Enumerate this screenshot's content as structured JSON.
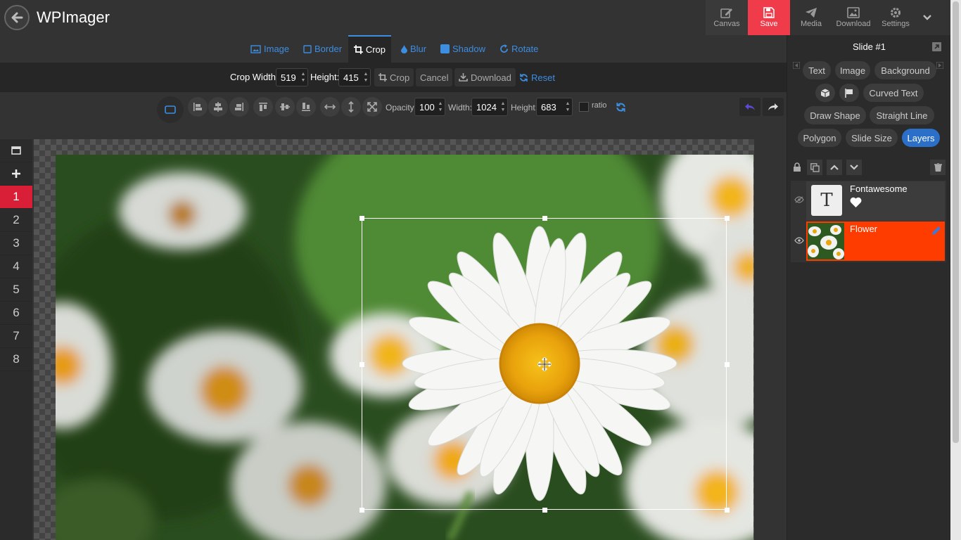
{
  "app": {
    "title": "WPImager"
  },
  "topbar": {
    "canvas_label": "Canvas",
    "save_label": "Save",
    "media_label": "Media",
    "download_label": "Download",
    "settings_label": "Settings",
    "save_color": "#ef3b4a"
  },
  "tabs": [
    {
      "label": "Image",
      "icon": "image-icon"
    },
    {
      "label": "Border",
      "icon": "square-icon"
    },
    {
      "label": "Crop",
      "icon": "crop-icon"
    },
    {
      "label": "Blur",
      "icon": "droplet-icon"
    },
    {
      "label": "Shadow",
      "icon": "shadow-square-icon"
    },
    {
      "label": "Rotate",
      "icon": "rotate-icon"
    }
  ],
  "crop": {
    "width_label": "Crop Width:",
    "width_value": "519",
    "height_label": "Height:",
    "height_value": "415",
    "crop_button": "Crop",
    "cancel_button": "Cancel",
    "download_button": "Download",
    "reset_button": "Reset"
  },
  "toolbar": {
    "opacity_label": "Opacity:",
    "opacity_value": "100",
    "width_label": "Width:",
    "width_value": "1024",
    "height_label": "Height:",
    "height_value": "683",
    "ratio_label": "ratio",
    "undo_color": "#5b4bd6"
  },
  "slides": {
    "numbers": [
      "1",
      "2",
      "3",
      "4",
      "5",
      "6",
      "7",
      "8"
    ],
    "active": "1",
    "accent_color": "#d91f37"
  },
  "panel": {
    "title": "Slide #1",
    "buttons_row1": [
      "Text",
      "Image",
      "Background"
    ],
    "buttons_row2": [
      "Curved Text"
    ],
    "buttons_row3": [
      "Draw Shape",
      "Straight Line"
    ],
    "buttons_row4": [
      "Polygon",
      "Slide Size",
      "Layers"
    ],
    "active_button": "Layers",
    "layers": [
      {
        "name": "Fontawesome",
        "thumb": "T",
        "selected": false
      },
      {
        "name": "Flower",
        "selected": true
      }
    ],
    "selected_layer_color": "#ff3c00"
  }
}
